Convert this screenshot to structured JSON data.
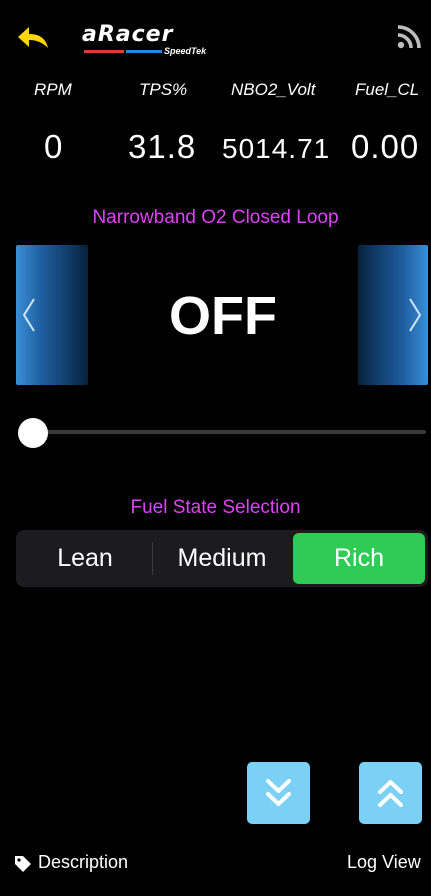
{
  "header": {
    "logo_text": "aRacer",
    "logo_subtext": "SpeedTek",
    "back_icon": "back-arrow-icon",
    "rss_icon": "rss-feed-icon",
    "accent_color": "#ffd60a"
  },
  "metrics": {
    "labels": [
      "RPM",
      "TPS%",
      "NBO2_Volt",
      "Fuel_CL"
    ],
    "values": [
      "0",
      "31.8",
      "5014.71",
      "0.00"
    ]
  },
  "closed_loop": {
    "title": "Narrowband O2 Closed Loop",
    "value": "OFF",
    "prev_icon": "chevron-left-icon",
    "next_icon": "chevron-right-icon",
    "slider_position": 0
  },
  "fuel_state": {
    "title": "Fuel State Selection",
    "options": [
      "Lean",
      "Medium",
      "Rich"
    ],
    "selected": "Rich",
    "selected_color": "#2ecc55"
  },
  "navigation": {
    "down_icon": "double-chevron-down-icon",
    "up_icon": "double-chevron-up-icon",
    "button_color": "#7ad0f5"
  },
  "footer": {
    "description_label": "Description",
    "description_icon": "tag-icon",
    "log_view_label": "Log View"
  },
  "title_color": "#e040fb"
}
